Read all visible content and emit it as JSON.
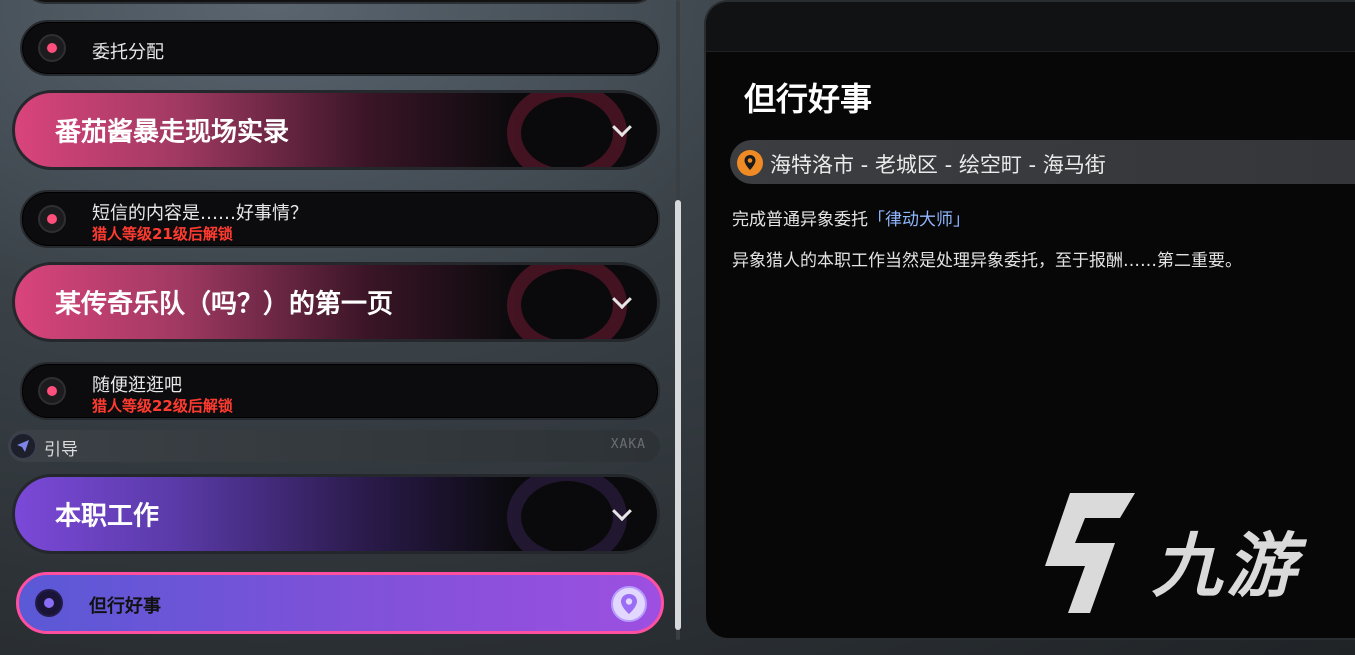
{
  "task_list": {
    "item_assign": {
      "label": "委托分配"
    },
    "group_1": {
      "title": "番茄酱暴走现场实录"
    },
    "item_sms": {
      "label": "短信的内容是……好事情？",
      "lock": "猎人等级21级后解锁"
    },
    "group_2": {
      "title": "某传奇乐队（吗？）的第一页"
    },
    "item_stroll": {
      "label": "随便逛逛吧",
      "lock": "猎人等级22级后解锁"
    },
    "guide": {
      "label": "引导",
      "tag": "XAKA"
    },
    "group_3": {
      "title": "本职工作"
    },
    "item_active": {
      "label": "但行好事",
      "icon": "location-pin-icon"
    }
  },
  "detail": {
    "title": "但行好事",
    "location": "海特洛市 - 老城区 - 绘空町 - 海马街",
    "objective_prefix": "完成普通异象委托",
    "objective_highlight": "「律动大师」",
    "description": "异象猎人的本职工作当然是处理异象委托，至于报酬……第二重要。"
  },
  "watermark": {
    "text": "九游"
  },
  "colors": {
    "accent_pink": "#ff4f7a",
    "lock_red": "#ff3b30",
    "active_purple": "#7a52d8",
    "active_border": "#ff4fa0",
    "location_orange": "#f08a24",
    "highlight_blue": "#8fb6ff"
  }
}
